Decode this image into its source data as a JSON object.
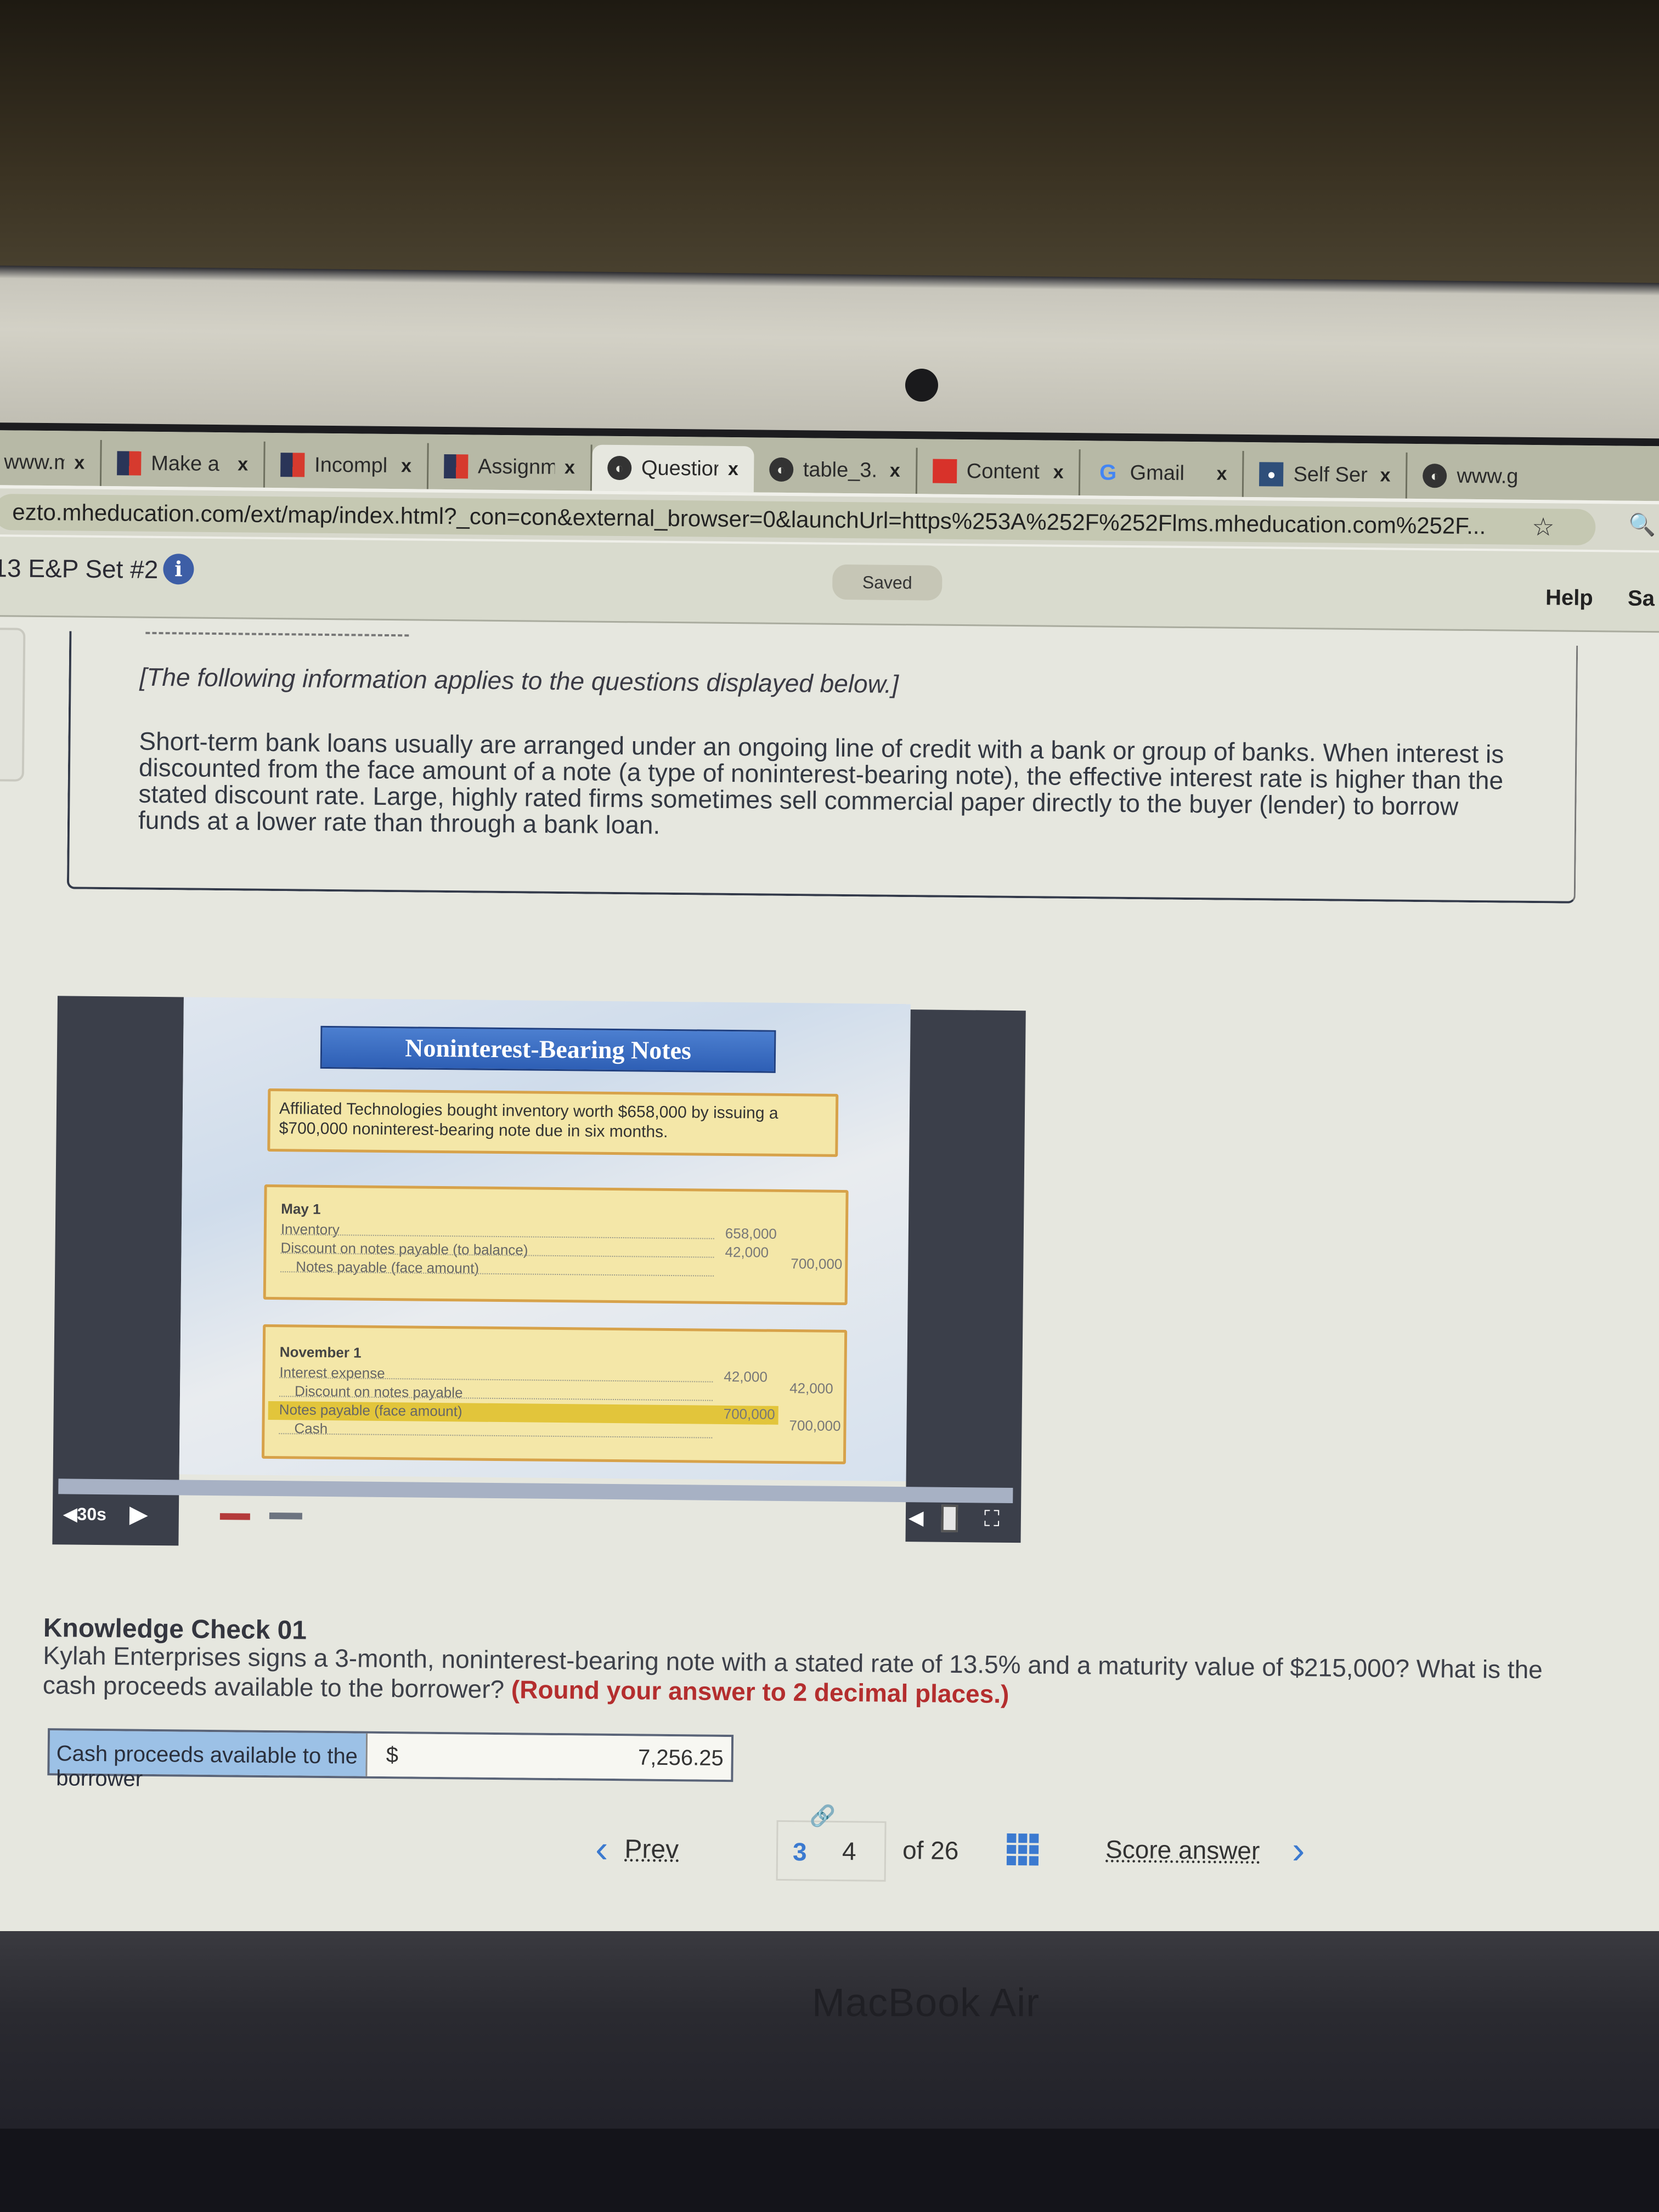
{
  "browser": {
    "tabs": [
      {
        "label": "www.my",
        "favicon": "partial",
        "active": false
      },
      {
        "label": "Make a",
        "favicon": "mheducation-icon",
        "active": false
      },
      {
        "label": "Incompl",
        "favicon": "mheducation-icon",
        "active": false
      },
      {
        "label": "Assignm",
        "favicon": "mheducation-icon",
        "active": false
      },
      {
        "label": "Questior",
        "favicon": "globe-icon",
        "active": true
      },
      {
        "label": "table_3.",
        "favicon": "globe-icon",
        "active": false
      },
      {
        "label": "Content",
        "favicon": "red-app-icon",
        "active": false
      },
      {
        "label": "Gmail",
        "favicon": "google-icon",
        "active": false
      },
      {
        "label": "Self Ser",
        "favicon": "person-icon",
        "active": false
      },
      {
        "label": "www.g",
        "favicon": "globe-icon",
        "active": false
      }
    ],
    "close_glyph": "x",
    "url": "ezto.mheducation.com/ext/map/index.html?_con=con&external_browser=0&launchUrl=https%253A%252F%252Flms.mheducation.com%252F..."
  },
  "header": {
    "assignment_title": "13 E&P Set #2",
    "info_glyph": "i",
    "saved_status": "Saved",
    "help_label": "Help",
    "save_exit_label": "Sa"
  },
  "intro": {
    "note": "[The following information applies to the questions displayed below.]",
    "paragraph": "Short-term bank loans usually are arranged under an ongoing line of credit with a bank or group of banks. When interest is discounted from the face amount of a note (a type of noninterest-bearing note), the effective interest rate is higher than the stated discount rate. Large, highly rated firms sometimes sell commercial paper directly to the buyer (lender) to borrow funds at a lower rate than through a bank loan."
  },
  "video": {
    "slide_title": "Noninterest-Bearing Notes",
    "description": "Affiliated Technologies bought inventory worth $658,000 by issuing a $700,000 noninterest-bearing note due in six months.",
    "entries": [
      {
        "date": "May 1",
        "lines": [
          {
            "account": "Inventory",
            "debit": "658,000",
            "credit": ""
          },
          {
            "account": "Discount on notes payable (to balance)",
            "debit": "42,000",
            "credit": ""
          },
          {
            "account": "Notes payable (face amount)",
            "debit": "",
            "credit": "700,000"
          }
        ]
      },
      {
        "date": "November 1",
        "lines": [
          {
            "account": "Interest expense",
            "debit": "42,000",
            "credit": ""
          },
          {
            "account": "Discount on notes payable",
            "debit": "",
            "credit": "42,000"
          },
          {
            "account": "Notes payable (face amount)",
            "debit": "700,000",
            "credit": ""
          },
          {
            "account": "Cash",
            "debit": "",
            "credit": "700,000"
          }
        ]
      }
    ],
    "rewind_label": "30s",
    "progress_fraction": 1.0
  },
  "question": {
    "title": "Knowledge Check 01",
    "text": "Kylah Enterprises signs a 3-month, noninterest-bearing note with a stated rate of 13.5% and a maturity value of $215,000? What is the cash proceeds available to the borrower?",
    "instruction": "(Round your answer to 2 decimal places.)",
    "answer_label": "Cash proceeds available to the borrower",
    "currency": "$",
    "answer_value": "7,256.25"
  },
  "nav": {
    "prev_label": "Prev",
    "pages": [
      "3",
      "4"
    ],
    "of_total": "of 26",
    "score_label": "Score answer"
  },
  "device": {
    "label": "MacBook Air"
  }
}
